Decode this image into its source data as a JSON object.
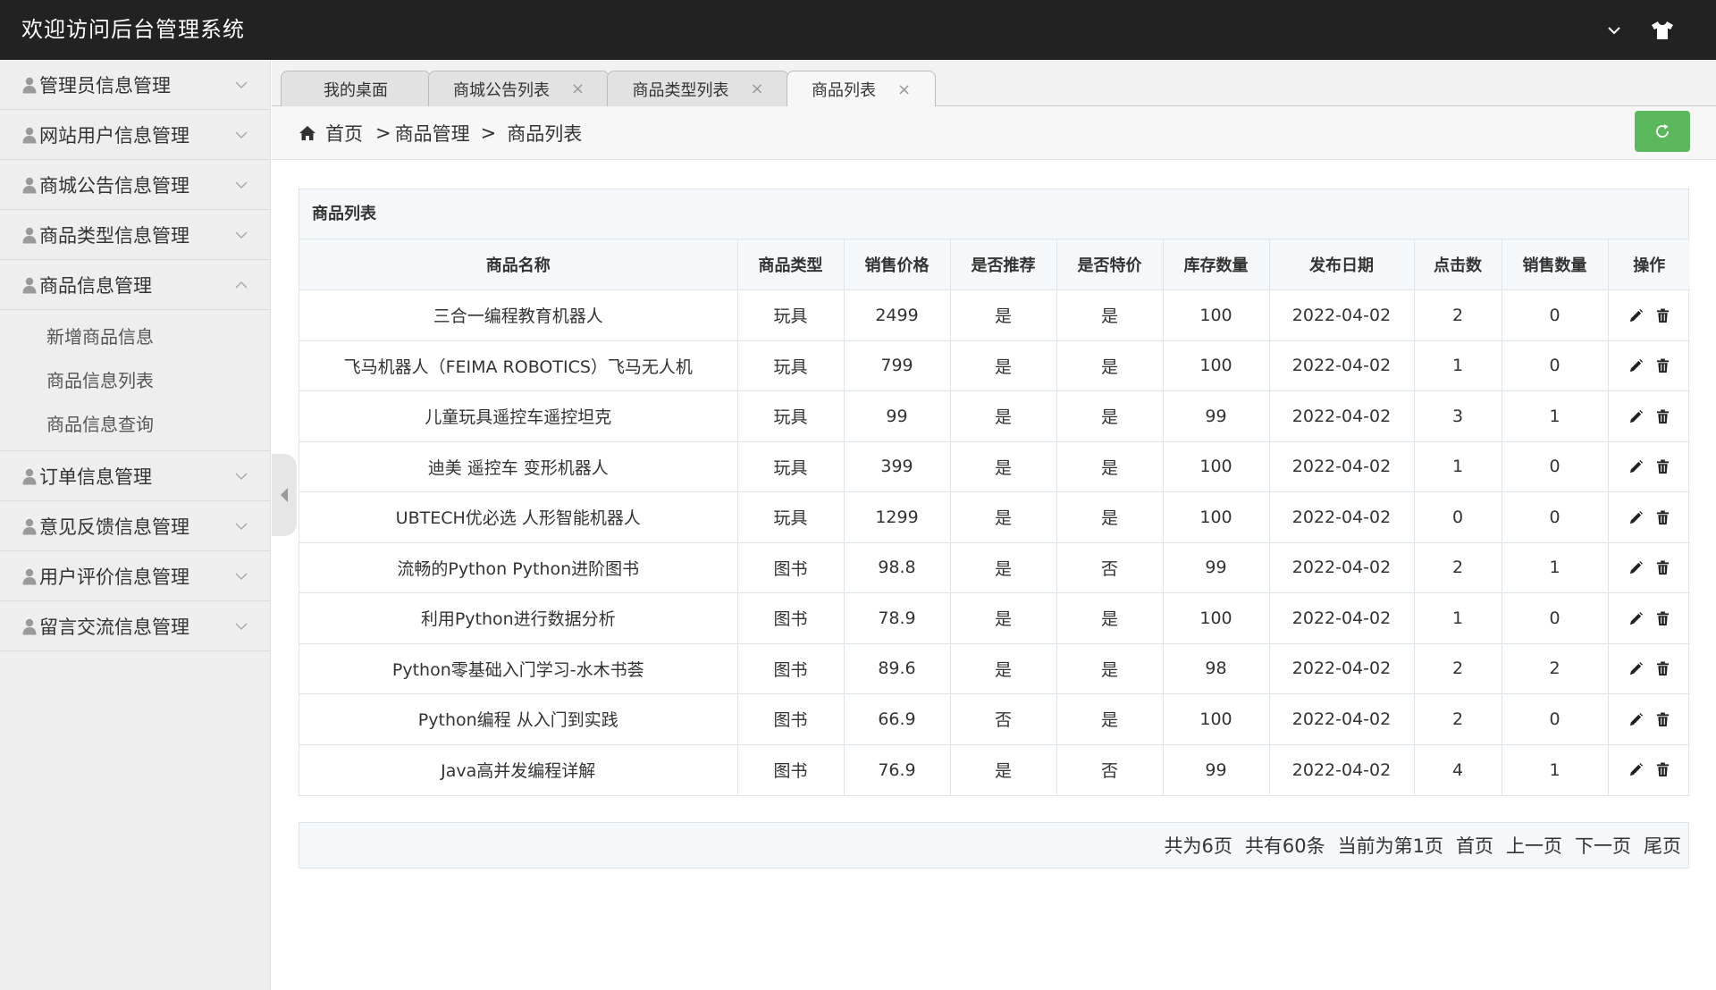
{
  "header": {
    "title": "欢迎访问后台管理系统",
    "icons": [
      "chevron-down-icon",
      "tshirt-icon"
    ]
  },
  "sidebar": {
    "items": [
      {
        "label": "管理员信息管理",
        "expanded": false
      },
      {
        "label": "网站用户信息管理",
        "expanded": false
      },
      {
        "label": "商城公告信息管理",
        "expanded": false
      },
      {
        "label": "商品类型信息管理",
        "expanded": false
      },
      {
        "label": "商品信息管理",
        "expanded": true,
        "children": [
          "新增商品信息",
          "商品信息列表",
          "商品信息查询"
        ]
      },
      {
        "label": "订单信息管理",
        "expanded": false
      },
      {
        "label": "意见反馈信息管理",
        "expanded": false
      },
      {
        "label": "用户评价信息管理",
        "expanded": false
      },
      {
        "label": "留言交流信息管理",
        "expanded": false
      }
    ]
  },
  "tabs": [
    {
      "label": "我的桌面",
      "closable": false,
      "active": false
    },
    {
      "label": "商城公告列表",
      "closable": true,
      "active": false
    },
    {
      "label": "商品类型列表",
      "closable": true,
      "active": false
    },
    {
      "label": "商品列表",
      "closable": true,
      "active": true
    }
  ],
  "tab_close_glyph": "×",
  "breadcrumb": {
    "items": [
      "首页",
      "商品管理",
      "商品列表"
    ],
    "separator": ">"
  },
  "panel": {
    "title": "商品列表",
    "columns": [
      "商品名称",
      "商品类型",
      "销售价格",
      "是否推荐",
      "是否特价",
      "库存数量",
      "发布日期",
      "点击数",
      "销售数量",
      "操作"
    ],
    "rows": [
      [
        "三合一编程教育机器人",
        "玩具",
        "2499",
        "是",
        "是",
        "100",
        "2022-04-02",
        "2",
        "0"
      ],
      [
        "飞马机器人（FEIMA ROBOTICS）飞马无人机",
        "玩具",
        "799",
        "是",
        "是",
        "100",
        "2022-04-02",
        "1",
        "0"
      ],
      [
        "儿童玩具遥控车遥控坦克",
        "玩具",
        "99",
        "是",
        "是",
        "99",
        "2022-04-02",
        "3",
        "1"
      ],
      [
        "迪美 遥控车 变形机器人",
        "玩具",
        "399",
        "是",
        "是",
        "100",
        "2022-04-02",
        "1",
        "0"
      ],
      [
        "UBTECH优必选 人形智能机器人",
        "玩具",
        "1299",
        "是",
        "是",
        "100",
        "2022-04-02",
        "0",
        "0"
      ],
      [
        "流畅的Python Python进阶图书",
        "图书",
        "98.8",
        "是",
        "否",
        "99",
        "2022-04-02",
        "2",
        "1"
      ],
      [
        "利用Python进行数据分析",
        "图书",
        "78.9",
        "是",
        "是",
        "100",
        "2022-04-02",
        "1",
        "0"
      ],
      [
        "Python零基础入门学习-水木书荟",
        "图书",
        "89.6",
        "是",
        "是",
        "98",
        "2022-04-02",
        "2",
        "2"
      ],
      [
        "Python编程 从入门到实践",
        "图书",
        "66.9",
        "否",
        "是",
        "100",
        "2022-04-02",
        "2",
        "0"
      ],
      [
        "Java高并发编程详解",
        "图书",
        "76.9",
        "是",
        "否",
        "99",
        "2022-04-02",
        "4",
        "1"
      ]
    ],
    "row_actions": [
      "edit-icon",
      "trash-icon"
    ]
  },
  "pager": {
    "total_pages": "共为6页",
    "total_items": "共有60条",
    "current": "当前为第1页",
    "first": "首页",
    "prev": "上一页",
    "next": "下一页",
    "last": "尾页"
  },
  "colors": {
    "header_bg": "#222222",
    "sidebar_bg": "#eeeeee",
    "refresh_button": "#5cb85c",
    "panel_heading_bg": "#f5f8fb",
    "border": "#dde4ea"
  }
}
